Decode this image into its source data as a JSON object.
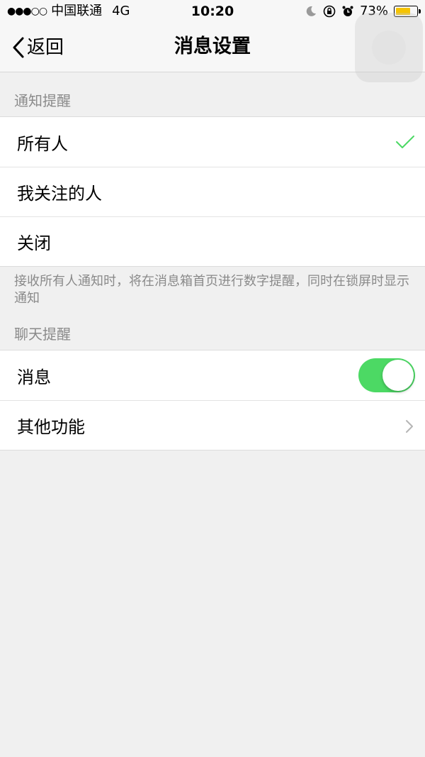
{
  "status_bar": {
    "signal": "●●●○○",
    "carrier": "中国联通",
    "network": "4G",
    "time": "10:20",
    "battery_percent": "73%",
    "battery_level": 0.73,
    "icons": [
      "moon-icon",
      "rotation-lock-icon",
      "alarm-icon",
      "battery-icon"
    ]
  },
  "nav": {
    "back_label": "返回",
    "title": "消息设置"
  },
  "notify_section": {
    "header": "通知提醒",
    "options": [
      {
        "label": "所有人",
        "selected": true
      },
      {
        "label": "我关注的人",
        "selected": false
      },
      {
        "label": "关闭",
        "selected": false
      }
    ],
    "footnote": "接收所有人通知时，将在消息箱首页进行数字提醒，同时在锁屏时显示通知"
  },
  "chat_section": {
    "header": "聊天提醒",
    "message_label": "消息",
    "message_enabled": true,
    "other_label": "其他功能"
  },
  "colors": {
    "accent_green": "#4cd964",
    "check_green": "#4cd964",
    "battery_yellow": "#f5c300"
  }
}
